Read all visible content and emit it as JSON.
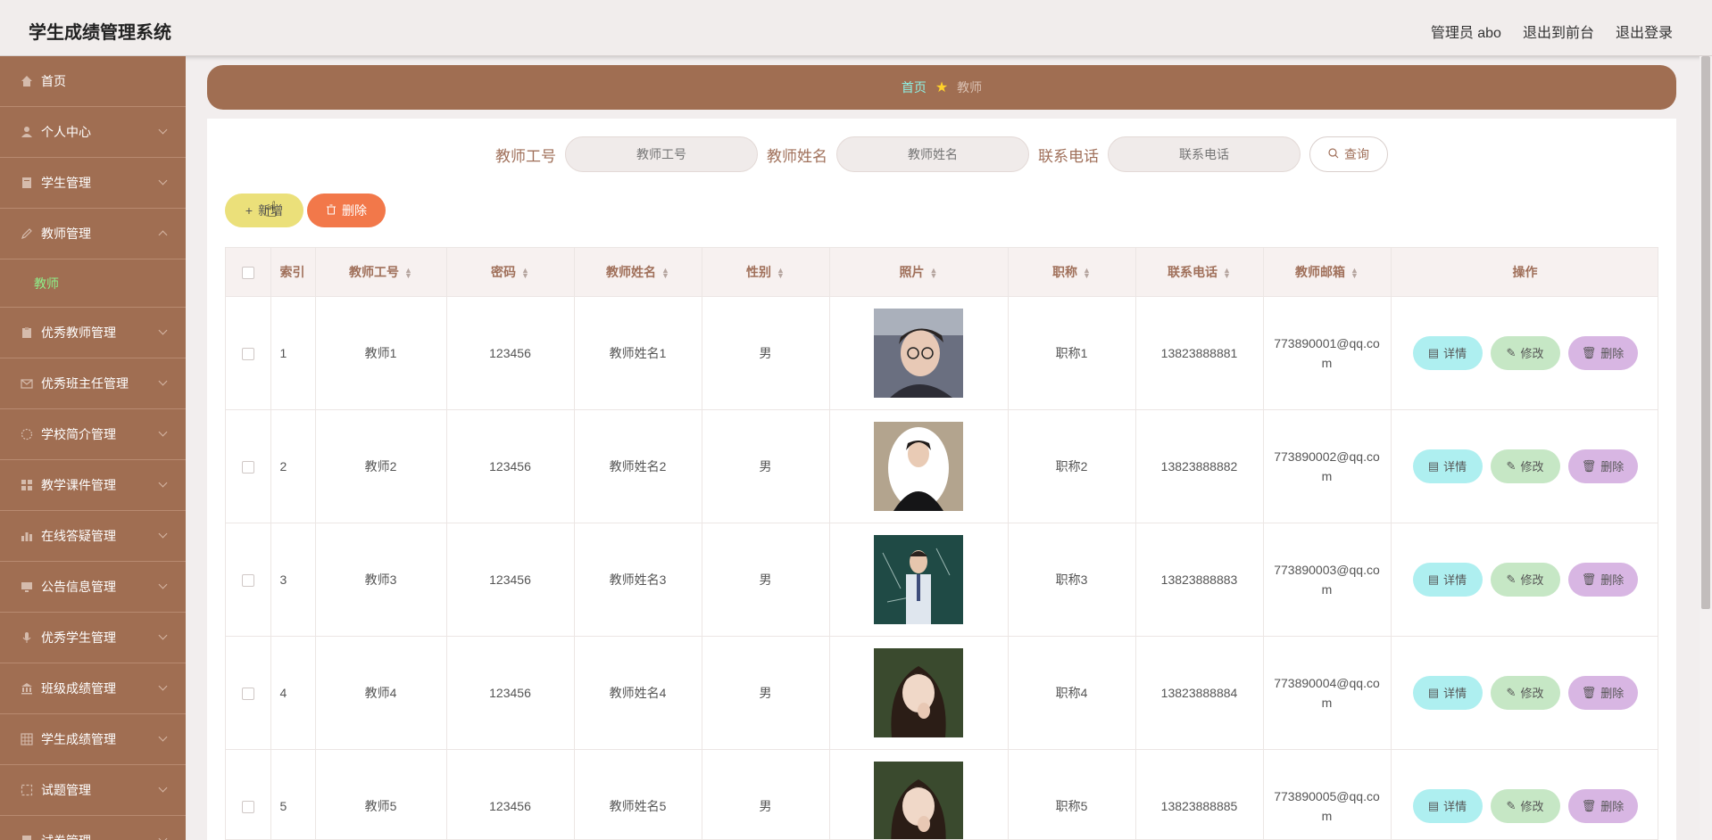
{
  "header": {
    "title": "学生成绩管理系统",
    "user": "管理员 abo",
    "to_front": "退出到前台",
    "logout": "退出登录"
  },
  "sidebar": {
    "items": [
      {
        "label": "首页",
        "icon": "home-icon",
        "has_children": false
      },
      {
        "label": "个人中心",
        "icon": "user-icon",
        "has_children": true
      },
      {
        "label": "学生管理",
        "icon": "book-icon",
        "has_children": true
      },
      {
        "label": "教师管理",
        "icon": "pen-icon",
        "has_children": true,
        "expanded": true,
        "children": [
          {
            "label": "教师"
          }
        ]
      },
      {
        "label": "优秀教师管理",
        "icon": "clipboard-icon",
        "has_children": true
      },
      {
        "label": "优秀班主任管理",
        "icon": "mail-icon",
        "has_children": true
      },
      {
        "label": "学校简介管理",
        "icon": "compass-icon",
        "has_children": true
      },
      {
        "label": "教学课件管理",
        "icon": "grid-icon",
        "has_children": true
      },
      {
        "label": "在线答疑管理",
        "icon": "chart-icon",
        "has_children": true
      },
      {
        "label": "公告信息管理",
        "icon": "monitor-icon",
        "has_children": true
      },
      {
        "label": "优秀学生管理",
        "icon": "mic-icon",
        "has_children": true
      },
      {
        "label": "班级成绩管理",
        "icon": "bank-icon",
        "has_children": true
      },
      {
        "label": "学生成绩管理",
        "icon": "table-icon",
        "has_children": true
      },
      {
        "label": "试题管理",
        "icon": "frame-icon",
        "has_children": true
      },
      {
        "label": "试卷管理",
        "icon": "doc-icon",
        "has_children": true
      }
    ]
  },
  "breadcrumb": {
    "home": "首页",
    "current": "教师"
  },
  "search": {
    "fields": [
      {
        "label": "教师工号",
        "placeholder": "教师工号"
      },
      {
        "label": "教师姓名",
        "placeholder": "教师姓名"
      },
      {
        "label": "联系电话",
        "placeholder": "联系电话"
      }
    ],
    "button": "查询"
  },
  "actions": {
    "add": "新增",
    "delete": "删除"
  },
  "table": {
    "columns": [
      "索引",
      "教师工号",
      "密码",
      "教师姓名",
      "性别",
      "照片",
      "职称",
      "联系电话",
      "教师邮箱",
      "操作"
    ],
    "rows": [
      {
        "index": "1",
        "id": "教师1",
        "password": "123456",
        "name": "教师姓名1",
        "gender": "男",
        "title": "职称1",
        "phone": "13823888881",
        "email": "773890001@qq.com"
      },
      {
        "index": "2",
        "id": "教师2",
        "password": "123456",
        "name": "教师姓名2",
        "gender": "男",
        "title": "职称2",
        "phone": "13823888882",
        "email": "773890002@qq.com"
      },
      {
        "index": "3",
        "id": "教师3",
        "password": "123456",
        "name": "教师姓名3",
        "gender": "男",
        "title": "职称3",
        "phone": "13823888883",
        "email": "773890003@qq.com"
      },
      {
        "index": "4",
        "id": "教师4",
        "password": "123456",
        "name": "教师姓名4",
        "gender": "男",
        "title": "职称4",
        "phone": "13823888884",
        "email": "773890004@qq.com"
      },
      {
        "index": "5",
        "id": "教师5",
        "password": "123456",
        "name": "教师姓名5",
        "gender": "男",
        "title": "职称5",
        "phone": "13823888885",
        "email": "773890005@qq.com"
      }
    ],
    "row_actions": {
      "detail": "详情",
      "edit": "修改",
      "delete": "删除"
    }
  },
  "colors": {
    "sidebar": "#a06e52",
    "active_sub": "#8ef08a",
    "add_button": "#ebe07a",
    "delete_button": "#f2784a",
    "detail": "#aeeff0",
    "edit": "#c6e7c5",
    "row_delete": "#d8b6e3"
  }
}
